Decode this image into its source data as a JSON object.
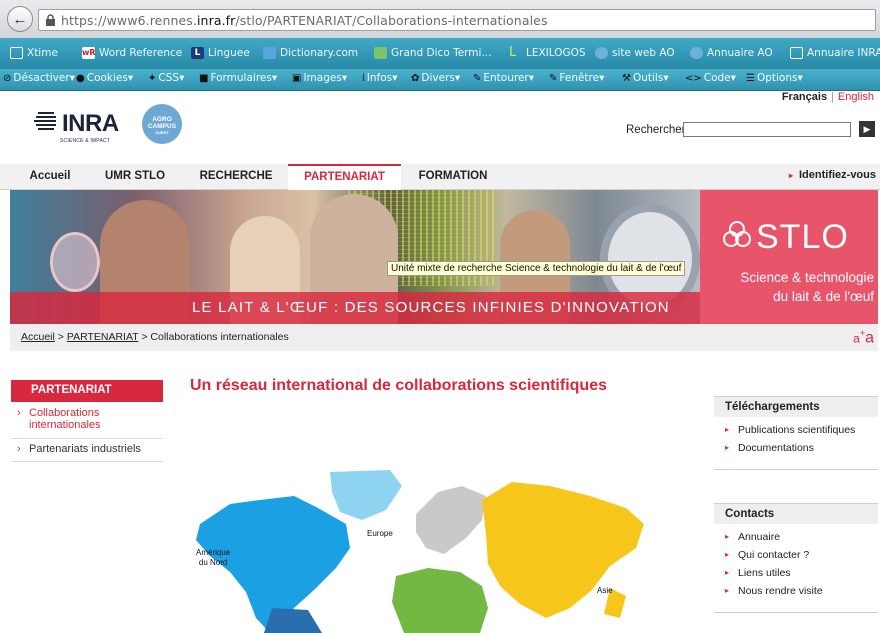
{
  "browser": {
    "url_prefix": "https://www6.rennes.",
    "url_host": "inra.fr",
    "url_path": "/stlo/PARTENARIAT/Collaborations-internationales",
    "bookmarks": [
      "Xtime",
      "Word Reference",
      "Linguee",
      "Dictionary.com",
      "Grand Dico Termi...",
      "LEXILOGOS",
      "site web AO",
      "Annuaire AO",
      "Annuaire INRA"
    ],
    "devtools": [
      "Désactiver",
      "Cookies",
      "CSS",
      "Formulaires",
      "Images",
      "Infos",
      "Divers",
      "Entourer",
      "Fenêtre",
      "Outils",
      "Code",
      "Options"
    ]
  },
  "header": {
    "lang_current": "Français",
    "lang_sep": "|",
    "lang_other": "English",
    "inra_word": "INRA",
    "inra_tag": "SCIENCE & IMPACT",
    "agro_line1": "AGRO",
    "agro_line2": "CAMPUS",
    "agro_line3": "OUEST",
    "search_label": "Rechercher"
  },
  "nav": {
    "items": [
      "Accueil",
      "UMR STLO",
      "RECHERCHE",
      "PARTENARIAT",
      "FORMATION"
    ],
    "login": "Identifiez-vous"
  },
  "banner": {
    "slogan": "LE LAIT & L'ŒUF : DES SOURCES INFINIES D'INNOVATION",
    "brand": "STLO",
    "sub1": "Science & technologie",
    "sub2": "du lait & de l'œuf",
    "tooltip": "Unité mixte de recherche Science & technologie du lait & de l'œuf"
  },
  "breadcrumb": {
    "home": "Accueil",
    "sep": ">",
    "section": "PARTENARIAT",
    "current": "Collaborations internationales",
    "textsize_a": "a",
    "textsize_plus": "+",
    "textsize_A": "a"
  },
  "sidebar": {
    "title": "PARTENARIAT",
    "items": [
      "Collaborations internationales",
      "Partenariats industriels"
    ]
  },
  "main": {
    "title": "Un réseau international de collaborations scientifiques",
    "map_labels": {
      "na": "Amérique\ndu Nord",
      "europe": "Europe",
      "asia": "Asie"
    }
  },
  "downloads": {
    "title": "Téléchargements",
    "items": [
      "Publications scientifiques",
      "Documentations"
    ]
  },
  "contacts": {
    "title": "Contacts",
    "items": [
      "Annuaire",
      "Qui contacter ?",
      "Liens utiles",
      "Nous rendre visite"
    ]
  },
  "colors": {
    "accent": "#d8283e",
    "nav_bg": "#f1f1f1",
    "bookmark_bar": "#2f93b0"
  }
}
